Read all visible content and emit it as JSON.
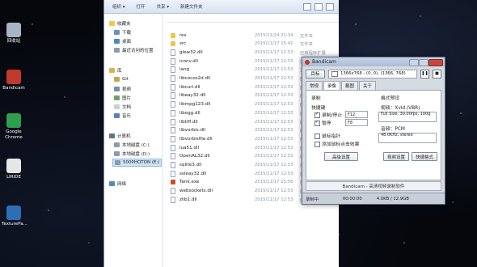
{
  "desktop": {
    "icons": [
      {
        "label": "回收站",
        "name": "recycle-bin-icon",
        "color": "#a7b4c4"
      },
      {
        "label": "Bandicam",
        "name": "bandicam-icon",
        "color": "#c0392b"
      },
      {
        "label": "Google\nChrome",
        "name": "chrome-icon",
        "color": "#2e9e4f"
      },
      {
        "label": "LIRIDE",
        "name": "liride-icon",
        "color": "#e6e6e6"
      },
      {
        "label": "TexturePa...",
        "name": "texturepacker-icon",
        "color": "#2c6fb5"
      }
    ]
  },
  "explorer": {
    "toolbar": {
      "organize": "组织 ▾",
      "open": "打开",
      "share": "共享 ▾",
      "new_folder": "新建文件夹"
    },
    "nav": {
      "favorites": "收藏夹",
      "downloads": "下载",
      "desktop": "桌面",
      "recent": "最近访问的位置",
      "libraries": "库",
      "git": "Git",
      "videos": "视频",
      "pictures": "图片",
      "documents": "文档",
      "music": "音乐",
      "computer": "计算机",
      "local_c": "本地磁盘 (C:)",
      "local_d": "本地磁盘 (D:)",
      "drive_e": "500PHOTON (E:)",
      "network": "网络"
    },
    "files": [
      {
        "name": "res",
        "date": "2015/11/24 21:34",
        "type": "文件夹",
        "kind": "folder"
      },
      {
        "name": "src",
        "date": "2015/11/17 15:41",
        "type": "文件夹",
        "kind": "folder"
      },
      {
        "name": "glew32.dll",
        "date": "2015/11/17 12:53",
        "type": "应用程序扩展",
        "kind": "file"
      },
      {
        "name": "iconv.dll",
        "date": "2015/11/17 12:53",
        "type": "应用程序扩展",
        "kind": "file"
      },
      {
        "name": "lang",
        "date": "2015/11/17 12:53",
        "type": "文件",
        "kind": "file"
      },
      {
        "name": "libcocos2d.dll",
        "date": "2015/11/17 12:53",
        "type": "应用程序扩展",
        "kind": "file"
      },
      {
        "name": "libcurl.dll",
        "date": "2015/11/17 12:53",
        "type": "应用程序扩展",
        "kind": "file"
      },
      {
        "name": "libeay32.dll",
        "date": "2015/11/17 12:53",
        "type": "应用程序扩展",
        "kind": "file"
      },
      {
        "name": "libmpg123.dll",
        "date": "2015/11/17 12:53",
        "type": "应用程序扩展",
        "kind": "file"
      },
      {
        "name": "libogg.dll",
        "date": "2015/11/17 12:53",
        "type": "应用程序扩展",
        "kind": "file"
      },
      {
        "name": "libtiff.dll",
        "date": "2015/11/17 12:53",
        "type": "应用程序扩展",
        "kind": "file"
      },
      {
        "name": "libvorbis.dll",
        "date": "2015/11/17 12:53",
        "type": "应用程序扩展",
        "kind": "file"
      },
      {
        "name": "libvorbisfile.dll",
        "date": "2015/11/17 12:53",
        "type": "应用程序扩展",
        "kind": "file"
      },
      {
        "name": "lua51.dll",
        "date": "2015/11/17 12:53",
        "type": "应用程序扩展",
        "kind": "file"
      },
      {
        "name": "OpenAL32.dll",
        "date": "2015/11/17 12:53",
        "type": "应用程序扩展",
        "kind": "file"
      },
      {
        "name": "sqlite3.dll",
        "date": "2015/11/17 12:53",
        "type": "应用程序扩展",
        "kind": "file"
      },
      {
        "name": "ssleay32.dll",
        "date": "2015/11/17 12:53",
        "type": "应用程序扩展",
        "kind": "file"
      },
      {
        "name": "Tank.exe",
        "date": "2015/11/17 15:56",
        "type": "应用程序",
        "kind": "exe"
      },
      {
        "name": "websockets.dll",
        "date": "2015/11/17 12:53",
        "type": "应用程序扩展",
        "kind": "file"
      },
      {
        "name": "zlib1.dll",
        "date": "2015/11/17 12:53",
        "type": "应用程序扩展",
        "kind": "file"
      }
    ]
  },
  "bandicam": {
    "title": "Bandicam",
    "target_button": "目标",
    "target_value": "1366x768 - (0, 0), (1366, 768)",
    "tabs": [
      "常规",
      "录像",
      "截图",
      "关于"
    ],
    "active_tab": "录像",
    "record_group": "录制",
    "hotkey_label": "快捷键",
    "rec_stop_label": "录制/停止",
    "rec_stop_key": "F12",
    "pause_label": "暂停",
    "pause_key": "F8",
    "show_cursor": "鼠标指针",
    "add_click_effect": "添加鼠标点击效果",
    "advanced_button": "高级设置",
    "format_group": "格式预设",
    "video_label": "视频：Xvid (VBR)",
    "video_detail": "Full Size, 30.00fps, 100q",
    "audio_label": "音频：PCM",
    "audio_detail": "48.0KHz, stereo",
    "video_settings_button": "视频设置",
    "quick_format_button": "快捷格式",
    "footer_text": "Bandicam - 高清视频录制软件",
    "status_state": "录制中",
    "status_time": "00:00:00",
    "status_size": "4.0KB / 12.9GB"
  }
}
